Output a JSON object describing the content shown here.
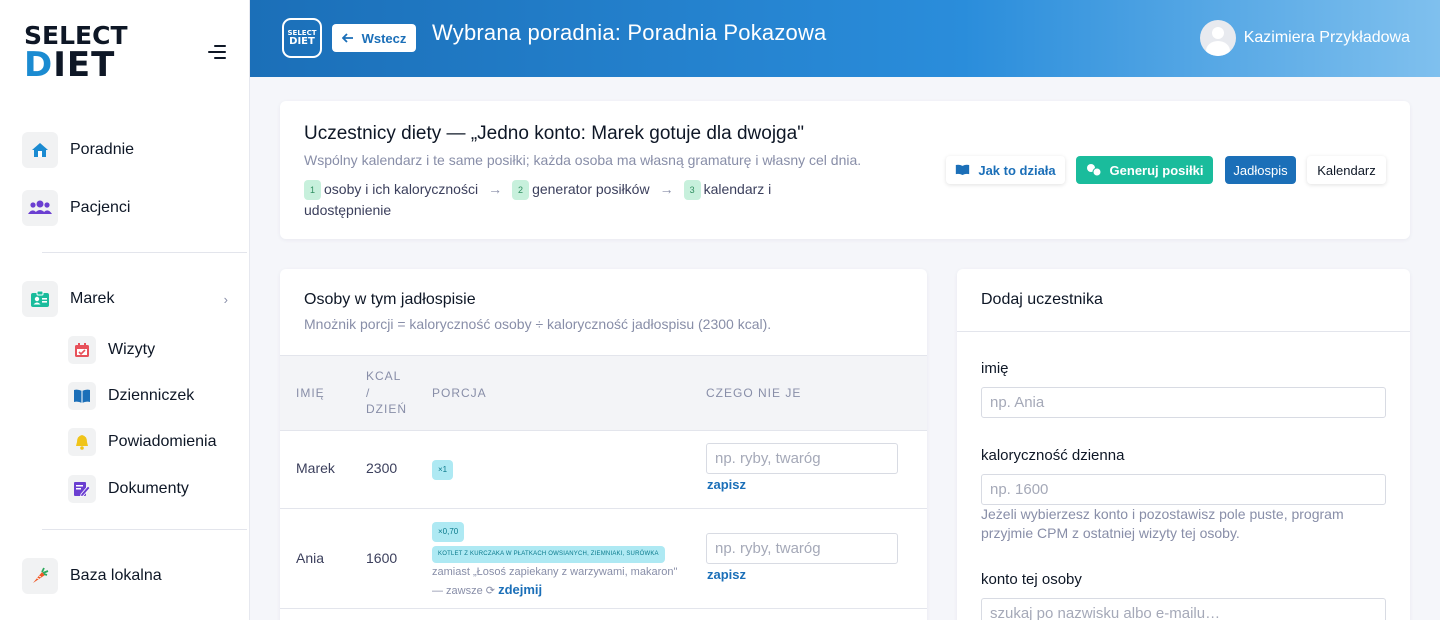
{
  "sidebar": {
    "logo_line1": "SELECT",
    "logo_line2_d": "D",
    "logo_line2_rest": "IET",
    "items": [
      {
        "label": "Poradnie",
        "icon": "home-icon"
      },
      {
        "label": "Pacjenci",
        "icon": "users-icon"
      },
      {
        "label": "Marek",
        "icon": "id-card-icon"
      },
      {
        "label": "Baza lokalna",
        "icon": "carrot-icon"
      }
    ],
    "sub_items": [
      {
        "label": "Wizyty",
        "icon": "calendar-icon"
      },
      {
        "label": "Dzienniczek",
        "icon": "book-icon"
      },
      {
        "label": "Powiadomienia",
        "icon": "bell-icon"
      },
      {
        "label": "Dokumenty",
        "icon": "document-icon"
      }
    ]
  },
  "header": {
    "logo_small_1": "SELECT",
    "logo_small_2": "DIET",
    "back_label": "Wstecz",
    "title": "Wybrana poradnia: Poradnia Pokazowa",
    "user_name": "Kazimiera Przykładowa"
  },
  "top_card": {
    "title": "Uczestnicy diety — „Jedno konto: Marek gotuje dla dwojga\"",
    "subtitle": "Wspólny kalendarz i te same posiłki; każda osoba ma własną gramaturę i własny cel dnia.",
    "steps": [
      {
        "num": "1",
        "label": "osoby i ich kaloryczności"
      },
      {
        "num": "2",
        "label": "generator posiłków"
      },
      {
        "num": "3",
        "label": "kalendarz i udostępnienie"
      }
    ],
    "arrow": "→",
    "buttons": {
      "how": "Jak to działa",
      "generate": "Generuj posiłki",
      "menu": "Jadłospis",
      "calendar": "Kalendarz"
    }
  },
  "persons": {
    "title": "Osoby w tym jadłospisie",
    "subtitle": "Mnożnik porcji = kaloryczność osoby ÷ kaloryczność jadłospisu (2300 kcal).",
    "columns": {
      "name": "Imię",
      "kcal_1": "kcal",
      "kcal_2": "/",
      "kcal_3": "dzień",
      "portion": "Porcja",
      "dislikes": "Czego nie je"
    },
    "rows": [
      {
        "name": "Marek",
        "kcal": "2300",
        "multiplier": "×1",
        "dislike_placeholder": "np. ryby, twaróg",
        "save": "zapisz"
      },
      {
        "name": "Ania",
        "kcal": "1600",
        "multiplier": "×0,70",
        "swap_badge": "kotlet z kurczaka w płatkach owsianych, ziemniaki, surówka",
        "swap_note": "zamiast „Łosoś zapiekany z warzywami, makaron\"",
        "swap_always": "— zawsze ⟳",
        "remove": "zdejmij",
        "dislike_placeholder": "np. ryby, twaróg",
        "save": "zapisz"
      }
    ]
  },
  "add_participant": {
    "title": "Dodaj uczestnika",
    "name_label": "imię",
    "name_placeholder": "np. Ania",
    "kcal_label": "kaloryczność dzienna",
    "kcal_placeholder": "np. 1600",
    "kcal_help": "Jeżeli wybierzesz konto i pozostawisz pole puste, program przyjmie CPM z ostatniej wizyty tej osoby.",
    "account_label": "konto tej osoby",
    "account_placeholder": "szukaj po nazwisku albo e-mailu…"
  }
}
